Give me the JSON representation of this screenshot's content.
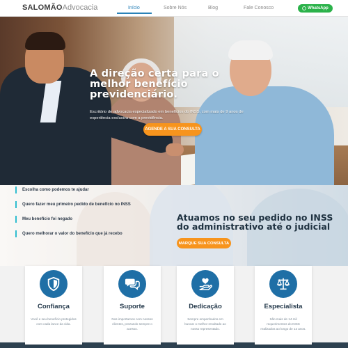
{
  "header": {
    "logo_bold": "SALOMÃO",
    "logo_light": "Advocacia",
    "nav": [
      "Início",
      "Sobre Nós",
      "Blog",
      "Fale Conosco"
    ],
    "active_nav": "Início",
    "whatsapp_label": "WhatsApp"
  },
  "hero": {
    "title": "A direção certa para o melhor benefício previdenciário.",
    "subtitle": "Escritório de advocacia especializado em benefícios do INSS, com mais de 9 anos de experiência exclusiva com a previdência.",
    "cta": "AGENDE A SUA CONSULTA"
  },
  "mid": {
    "list": [
      "Escolha como podemos te ajudar",
      "Quero fazer meu primeiro pedido de benefício no INSS",
      "Meu benefício foi negado",
      "Quero melhorar o valor do benefício que já recebo"
    ],
    "title": "Atuamos no seu pedido no INSS do administrativo até o judicial",
    "cta": "MARQUE SUA CONSULTA"
  },
  "cards": [
    {
      "icon": "shield-icon",
      "title": "Confiança",
      "text": "Você e seu benefício protegidos com cada lance da vida."
    },
    {
      "icon": "chat-bubbles-icon",
      "title": "Suporte",
      "text": "Nos importamos com nossos clientes, prezando sempre o acesso."
    },
    {
      "icon": "heart-hand-icon",
      "title": "Dedicação",
      "text": "Sempre empenhados em buscar o melhor resultado ao nosso representado."
    },
    {
      "icon": "scales-icon",
      "title": "Especialista",
      "text": "São mais de 14 mil requerimentos do INSS realizados ao longo de 12 anos."
    }
  ],
  "colors": {
    "accent_blue": "#2a82b8",
    "cta_orange": "#f7941d",
    "whatsapp_green": "#2bb24a",
    "icon_blue": "#1f6fa6",
    "list_bar": "#2fbdd0"
  }
}
